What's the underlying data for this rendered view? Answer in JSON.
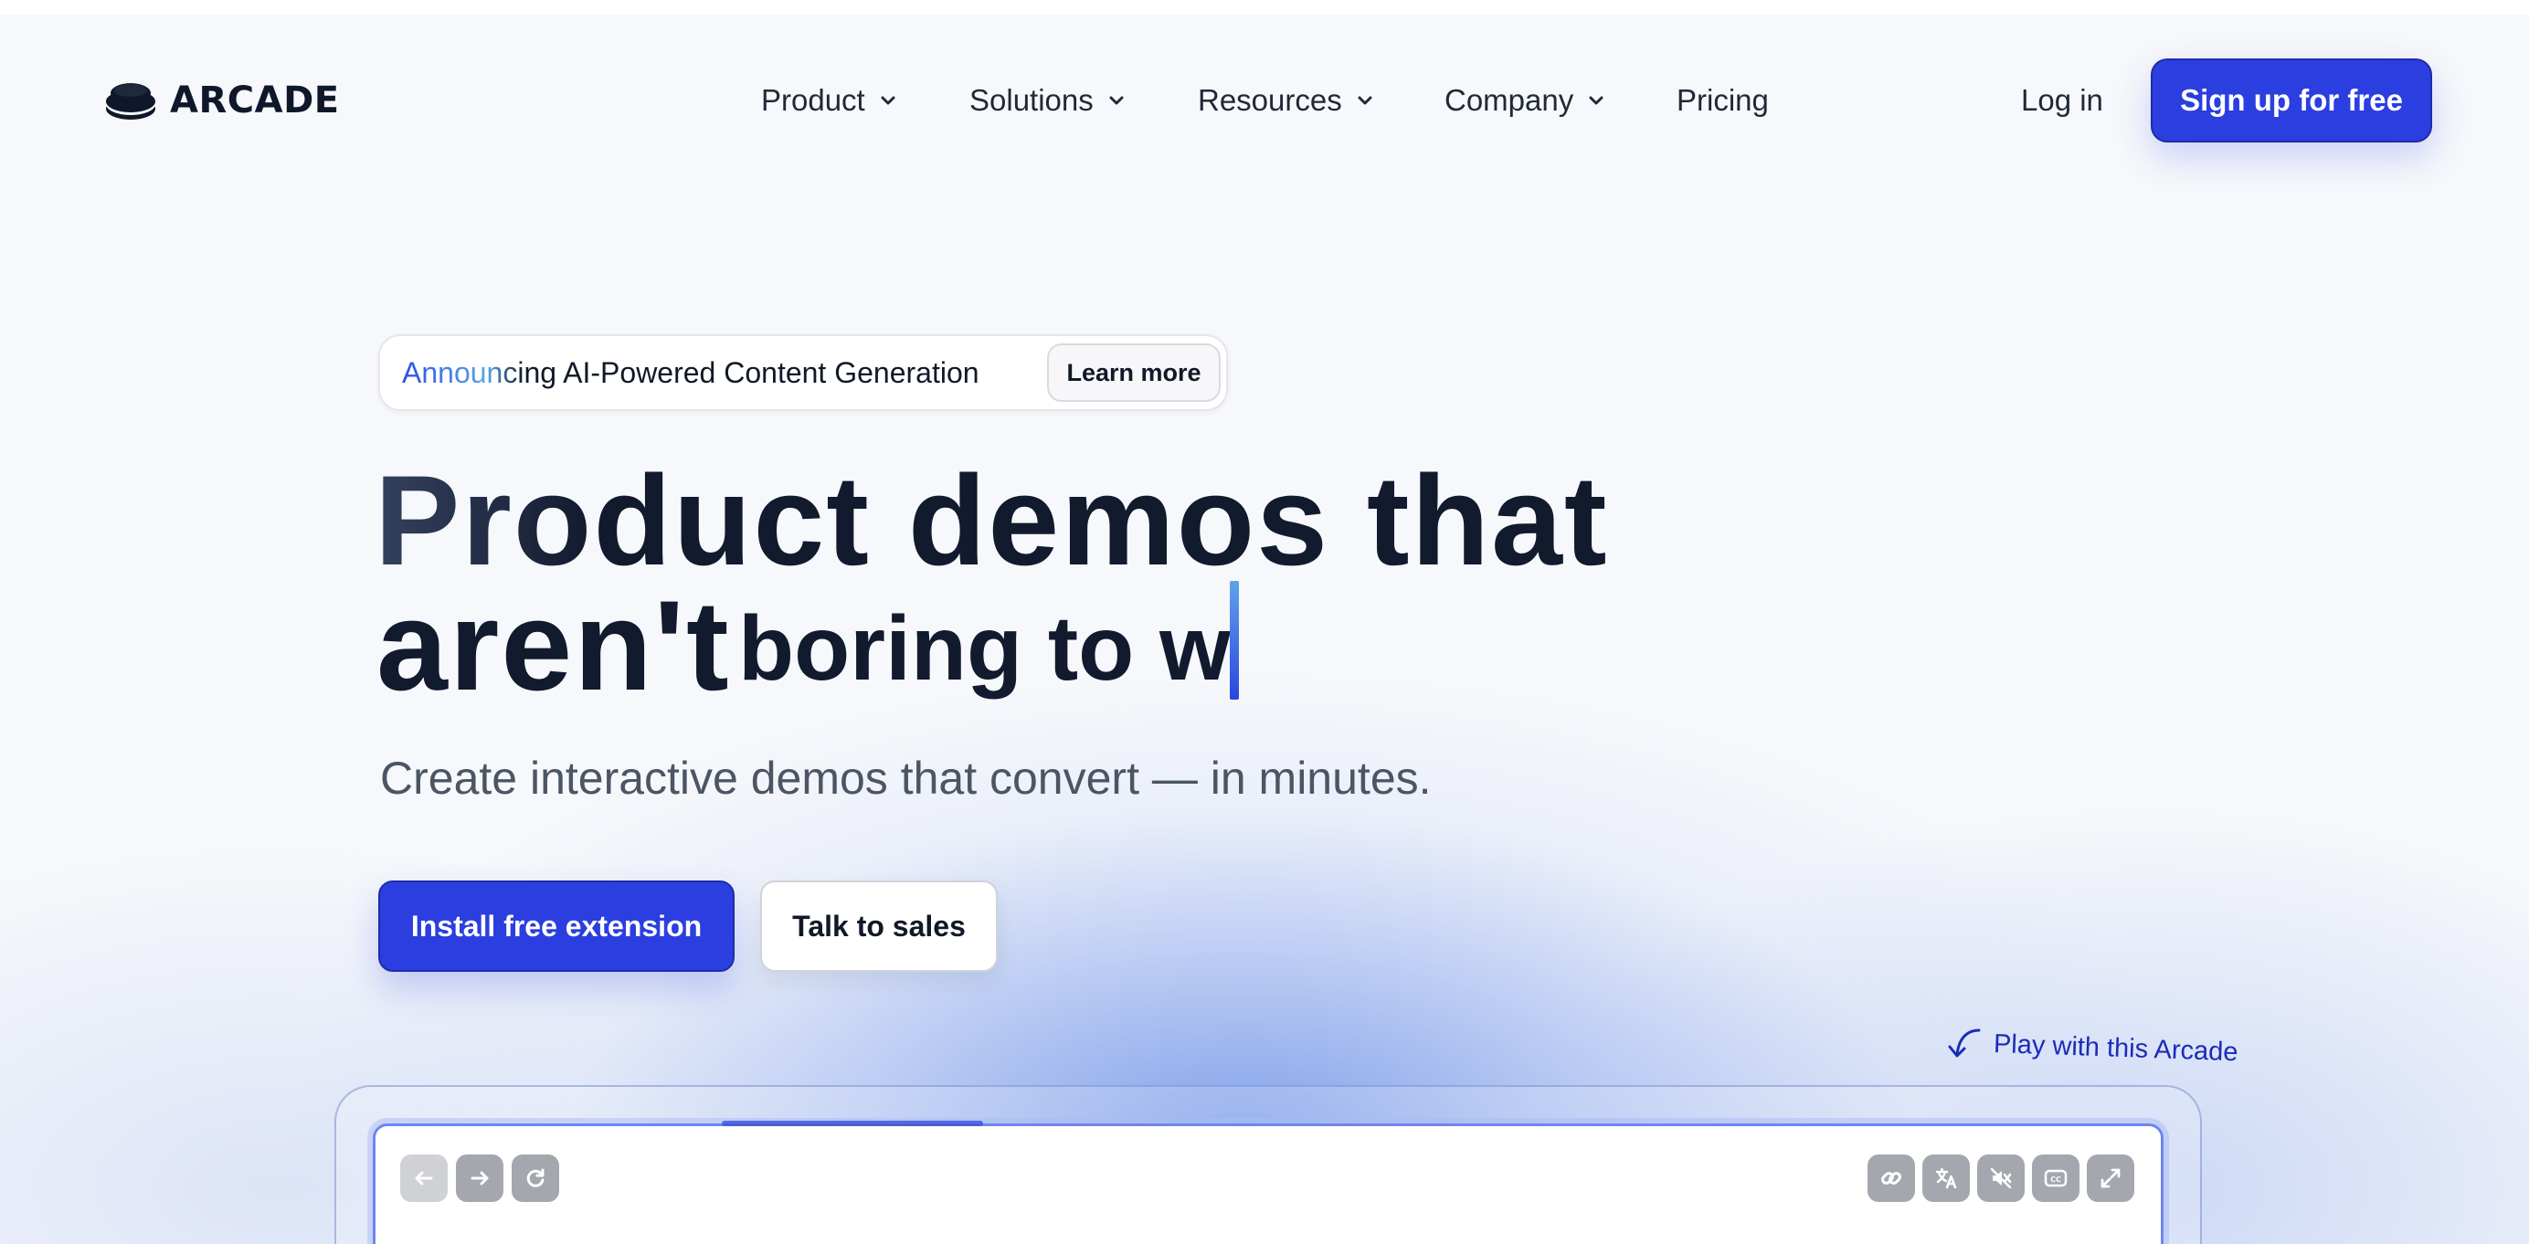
{
  "brand": {
    "name": "ARCADE",
    "icon": "arcade-logo-icon"
  },
  "nav": {
    "items": [
      {
        "label": "Product",
        "has_dropdown": true
      },
      {
        "label": "Solutions",
        "has_dropdown": true
      },
      {
        "label": "Resources",
        "has_dropdown": true
      },
      {
        "label": "Company",
        "has_dropdown": true
      },
      {
        "label": "Pricing",
        "has_dropdown": false
      }
    ],
    "login_label": "Log in",
    "signup_label": "Sign up for free"
  },
  "announcement": {
    "text_gradient": "Announci",
    "text_rest": "ng AI-Powered Content Generation",
    "link_label": "Learn more"
  },
  "hero": {
    "headline_line1_a": "Pro",
    "headline_line1_b": "duct demos that",
    "headline_line2": "aren't",
    "typed_text": "boring to w",
    "subheadline": "Create interactive demos that convert — in minutes."
  },
  "cta": {
    "primary_label": "Install free extension",
    "secondary_label": "Talk to sales"
  },
  "demo": {
    "hint": "Play with this Arcade",
    "toolbar_left": [
      "back-arrow-icon",
      "forward-arrow-icon",
      "refresh-icon"
    ],
    "toolbar_right": [
      "link-icon",
      "translate-icon",
      "mute-icon",
      "captions-icon",
      "fullscreen-icon"
    ]
  },
  "colors": {
    "accent": "#2b3fe0",
    "text_dark": "#121a2e",
    "text_muted": "#4b5563",
    "hint_blue": "#1b2bb8",
    "toolbar_gray": "#a4a7ad"
  }
}
